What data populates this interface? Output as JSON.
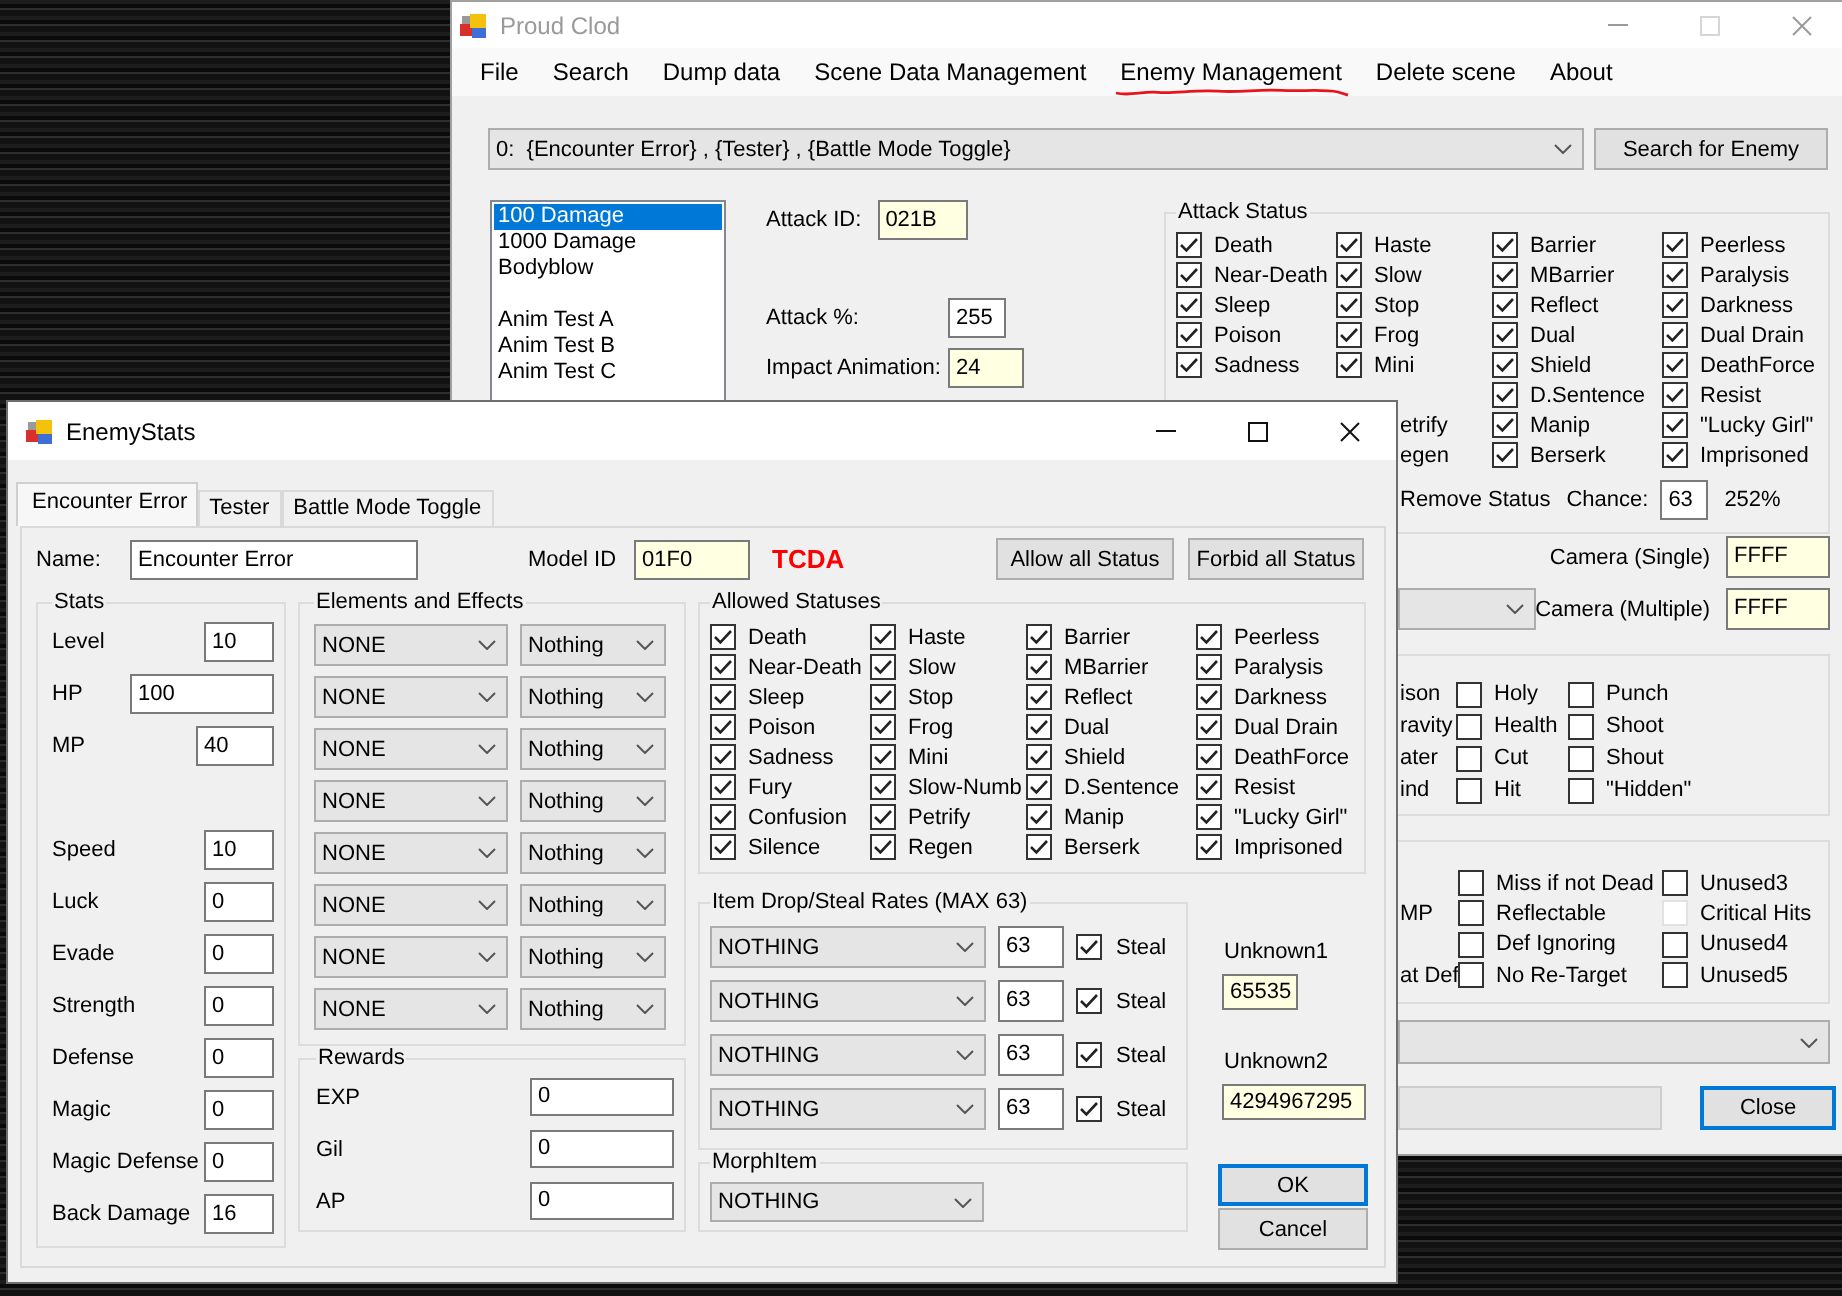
{
  "main_window": {
    "title": "Proud Clod",
    "active": false,
    "menu": [
      {
        "label": "File",
        "underlined": false
      },
      {
        "label": "Search",
        "underlined": false
      },
      {
        "label": "Dump data",
        "underlined": false
      },
      {
        "label": "Scene Data Management",
        "underlined": false
      },
      {
        "label": "Enemy Management",
        "underlined": true
      },
      {
        "label": "Delete scene",
        "underlined": false
      },
      {
        "label": "About",
        "underlined": false
      }
    ],
    "scene_select": {
      "value": "0:  {Encounter Error} , {Tester} , {Battle Mode Toggle}"
    },
    "search_button": "Search for Enemy",
    "attack_list": [
      {
        "kind": "item",
        "label": "100 Damage",
        "selected": true
      },
      {
        "kind": "item",
        "label": "1000 Damage",
        "selected": false
      },
      {
        "kind": "item",
        "label": "Bodyblow",
        "selected": false
      },
      {
        "kind": "blank"
      },
      {
        "kind": "item",
        "label": "Anim Test A",
        "selected": false
      },
      {
        "kind": "item",
        "label": "Anim Test B",
        "selected": false
      },
      {
        "kind": "item",
        "label": "Anim Test C",
        "selected": false
      }
    ],
    "attack_fields": [
      {
        "label": "Attack ID:",
        "value": "021B",
        "highlighted": true
      },
      {
        "label": "Attack %:",
        "value": "255",
        "highlighted": false
      },
      {
        "label": "Impact Animation:",
        "value": "24",
        "highlighted": true
      }
    ],
    "attack_status": {
      "title": "Attack Status",
      "rows": [
        [
          {
            "kind": "checkbox",
            "label": "Death",
            "checked": true
          },
          {
            "kind": "checkbox",
            "label": "Haste",
            "checked": true
          },
          {
            "kind": "checkbox",
            "label": "Barrier",
            "checked": true
          },
          {
            "kind": "checkbox",
            "label": "Peerless",
            "checked": true
          }
        ],
        [
          {
            "kind": "checkbox",
            "label": "Near-Death",
            "checked": true
          },
          {
            "kind": "checkbox",
            "label": "Slow",
            "checked": true
          },
          {
            "kind": "checkbox",
            "label": "MBarrier",
            "checked": true
          },
          {
            "kind": "checkbox",
            "label": "Paralysis",
            "checked": true
          }
        ],
        [
          {
            "kind": "checkbox",
            "label": "Sleep",
            "checked": true
          },
          {
            "kind": "checkbox",
            "label": "Stop",
            "checked": true
          },
          {
            "kind": "checkbox",
            "label": "Reflect",
            "checked": true
          },
          {
            "kind": "checkbox",
            "label": "Darkness",
            "checked": true
          }
        ],
        [
          {
            "kind": "checkbox",
            "label": "Poison",
            "checked": true
          },
          {
            "kind": "checkbox",
            "label": "Frog",
            "checked": true
          },
          {
            "kind": "checkbox",
            "label": "Dual",
            "checked": true
          },
          {
            "kind": "checkbox",
            "label": "Dual Drain",
            "checked": true
          }
        ],
        [
          {
            "kind": "checkbox",
            "label": "Sadness",
            "checked": true
          },
          {
            "kind": "checkbox",
            "label": "Mini",
            "checked": true
          },
          {
            "kind": "checkbox",
            "label": "Shield",
            "checked": true
          },
          {
            "kind": "checkbox",
            "label": "DeathForce",
            "checked": true
          }
        ],
        [
          "",
          "",
          {
            "kind": "checkbox",
            "label": "D.Sentence",
            "checked": true
          },
          {
            "kind": "checkbox",
            "label": "Resist",
            "checked": true
          }
        ],
        [
          "",
          {
            "kind": "fragment",
            "label": "etrify"
          },
          {
            "kind": "checkbox",
            "label": "Manip",
            "checked": true
          },
          {
            "kind": "checkbox",
            "label": "\"Lucky Girl\"",
            "checked": true
          }
        ],
        [
          "",
          {
            "kind": "fragment",
            "label": "egen"
          },
          {
            "kind": "checkbox",
            "label": "Berserk",
            "checked": true
          },
          {
            "kind": "checkbox",
            "label": "Imprisoned",
            "checked": true
          }
        ]
      ],
      "remove_status": "Remove Status",
      "chance_label": "Chance:",
      "chance": "63",
      "chance_percent": "252%"
    },
    "camera_rows": [
      {
        "label": "Camera (Single)",
        "value": "FFFF",
        "highlighted": true,
        "dropdown": false
      },
      {
        "label": "Camera (Multiple)",
        "value": "FFFF",
        "highlighted": true,
        "dropdown": true
      }
    ],
    "element_group": {
      "rows": [
        [
          {
            "kind": "fragment",
            "label": "ison"
          },
          {
            "kind": "checkbox",
            "label": "Holy",
            "checked": false
          },
          {
            "kind": "checkbox",
            "label": "Punch",
            "checked": false
          }
        ],
        [
          {
            "kind": "fragment",
            "label": "ravity"
          },
          {
            "kind": "checkbox",
            "label": "Health",
            "checked": false
          },
          {
            "kind": "checkbox",
            "label": "Shoot",
            "checked": false
          }
        ],
        [
          {
            "kind": "fragment",
            "label": "ater"
          },
          {
            "kind": "checkbox",
            "label": "Cut",
            "checked": false
          },
          {
            "kind": "checkbox",
            "label": "Shout",
            "checked": false
          }
        ],
        [
          {
            "kind": "fragment",
            "label": "ind"
          },
          {
            "kind": "checkbox",
            "label": "Hit",
            "checked": false
          },
          {
            "kind": "checkbox",
            "label": "\"Hidden\"",
            "checked": false
          }
        ]
      ]
    },
    "flag_group": {
      "rows": [
        [
          "",
          {
            "kind": "checkbox",
            "label": "Miss if not Dead",
            "checked": false,
            "disabled": false
          },
          {
            "kind": "checkbox",
            "label": "Unused3",
            "checked": false,
            "disabled": false
          }
        ],
        [
          {
            "kind": "fragment",
            "label": "MP"
          },
          {
            "kind": "checkbox",
            "label": "Reflectable",
            "checked": false,
            "disabled": false
          },
          {
            "kind": "checkbox",
            "label": "Critical Hits",
            "checked": false,
            "disabled": true
          }
        ],
        [
          "",
          {
            "kind": "checkbox",
            "label": "Def Ignoring",
            "checked": false,
            "disabled": false
          },
          {
            "kind": "checkbox",
            "label": "Unused4",
            "checked": false,
            "disabled": false
          }
        ],
        [
          {
            "kind": "fragment",
            "label": "at Def"
          },
          {
            "kind": "checkbox",
            "label": "No Re-Target",
            "checked": false,
            "disabled": false
          },
          {
            "kind": "checkbox",
            "label": "Unused5",
            "checked": false,
            "disabled": false
          }
        ]
      ]
    },
    "lower_controls": [
      {
        "kind": "dropdown"
      },
      {
        "kind": "field",
        "disabled": true
      },
      {
        "kind": "button",
        "label": "Close",
        "focused": true
      }
    ]
  },
  "enemy_window": {
    "title": "EnemyStats",
    "active": true,
    "tabs": [
      {
        "label": "Encounter Error",
        "selected": true
      },
      {
        "label": "Tester",
        "selected": false
      },
      {
        "label": "Battle Mode Toggle",
        "selected": false
      }
    ],
    "name_label": "Name:",
    "name": "Encounter Error",
    "model_id_label": "Model ID",
    "model_id": "01F0",
    "model_code": "TCDA",
    "status_buttons": [
      "Allow all Status",
      "Forbid all Status"
    ],
    "stats": {
      "title": "Stats",
      "groups": [
        [
          {
            "label": "Level",
            "value": "10"
          },
          {
            "label": "HP",
            "value": "100"
          },
          {
            "label": "MP",
            "value": "40"
          }
        ],
        [
          {
            "label": "Speed",
            "value": "10"
          },
          {
            "label": "Luck",
            "value": "0"
          },
          {
            "label": "Evade",
            "value": "0"
          },
          {
            "label": "Strength",
            "value": "0"
          },
          {
            "label": "Defense",
            "value": "0"
          },
          {
            "label": "Magic",
            "value": "0"
          },
          {
            "label": "Magic Defense",
            "value": "0"
          },
          {
            "label": "Back Damage",
            "value": "16"
          }
        ]
      ]
    },
    "elements": {
      "title": "Elements and Effects",
      "rows": [
        {
          "element": "NONE",
          "effect": "Nothing"
        },
        {
          "element": "NONE",
          "effect": "Nothing"
        },
        {
          "element": "NONE",
          "effect": "Nothing"
        },
        {
          "element": "NONE",
          "effect": "Nothing"
        },
        {
          "element": "NONE",
          "effect": "Nothing"
        },
        {
          "element": "NONE",
          "effect": "Nothing"
        },
        {
          "element": "NONE",
          "effect": "Nothing"
        },
        {
          "element": "NONE",
          "effect": "Nothing"
        }
      ]
    },
    "rewards": {
      "title": "Rewards",
      "rows": [
        {
          "label": "EXP",
          "value": "0"
        },
        {
          "label": "Gil",
          "value": "0"
        },
        {
          "label": "AP",
          "value": "0"
        }
      ]
    },
    "allowed_statuses": {
      "title": "Allowed Statuses",
      "rows": [
        [
          {
            "kind": "checkbox",
            "label": "Death",
            "checked": true
          },
          {
            "kind": "checkbox",
            "label": "Haste",
            "checked": true
          },
          {
            "kind": "checkbox",
            "label": "Barrier",
            "checked": true
          },
          {
            "kind": "checkbox",
            "label": "Peerless",
            "checked": true
          }
        ],
        [
          {
            "kind": "checkbox",
            "label": "Near-Death",
            "checked": true
          },
          {
            "kind": "checkbox",
            "label": "Slow",
            "checked": true
          },
          {
            "kind": "checkbox",
            "label": "MBarrier",
            "checked": true
          },
          {
            "kind": "checkbox",
            "label": "Paralysis",
            "checked": true
          }
        ],
        [
          {
            "kind": "checkbox",
            "label": "Sleep",
            "checked": true
          },
          {
            "kind": "checkbox",
            "label": "Stop",
            "checked": true
          },
          {
            "kind": "checkbox",
            "label": "Reflect",
            "checked": true
          },
          {
            "kind": "checkbox",
            "label": "Darkness",
            "checked": true
          }
        ],
        [
          {
            "kind": "checkbox",
            "label": "Poison",
            "checked": true
          },
          {
            "kind": "checkbox",
            "label": "Frog",
            "checked": true
          },
          {
            "kind": "checkbox",
            "label": "Dual",
            "checked": true
          },
          {
            "kind": "checkbox",
            "label": "Dual Drain",
            "checked": true
          }
        ],
        [
          {
            "kind": "checkbox",
            "label": "Sadness",
            "checked": true
          },
          {
            "kind": "checkbox",
            "label": "Mini",
            "checked": true
          },
          {
            "kind": "checkbox",
            "label": "Shield",
            "checked": true
          },
          {
            "kind": "checkbox",
            "label": "DeathForce",
            "checked": true
          }
        ],
        [
          {
            "kind": "checkbox",
            "label": "Fury",
            "checked": true
          },
          {
            "kind": "checkbox",
            "label": "Slow-Numb",
            "checked": true
          },
          {
            "kind": "checkbox",
            "label": "D.Sentence",
            "checked": true
          },
          {
            "kind": "checkbox",
            "label": "Resist",
            "checked": true
          }
        ],
        [
          {
            "kind": "checkbox",
            "label": "Confusion",
            "checked": true
          },
          {
            "kind": "checkbox",
            "label": "Petrify",
            "checked": true
          },
          {
            "kind": "checkbox",
            "label": "Manip",
            "checked": true
          },
          {
            "kind": "checkbox",
            "label": "\"Lucky Girl\"",
            "checked": true
          }
        ],
        [
          {
            "kind": "checkbox",
            "label": "Silence",
            "checked": true
          },
          {
            "kind": "checkbox",
            "label": "Regen",
            "checked": true
          },
          {
            "kind": "checkbox",
            "label": "Berserk",
            "checked": true
          },
          {
            "kind": "checkbox",
            "label": "Imprisoned",
            "checked": true
          }
        ]
      ]
    },
    "drops": {
      "title": "Item Drop/Steal Rates (MAX 63)",
      "rows": [
        {
          "item": "NOTHING",
          "rate": "63",
          "steal": {
            "label": "Steal",
            "checked": true
          }
        },
        {
          "item": "NOTHING",
          "rate": "63",
          "steal": {
            "label": "Steal",
            "checked": true
          }
        },
        {
          "item": "NOTHING",
          "rate": "63",
          "steal": {
            "label": "Steal",
            "checked": true
          }
        },
        {
          "item": "NOTHING",
          "rate": "63",
          "steal": {
            "label": "Steal",
            "checked": true
          }
        }
      ]
    },
    "unknowns": [
      {
        "label": "Unknown1",
        "value": "65535",
        "highlighted": true
      },
      {
        "label": "Unknown2",
        "value": "4294967295",
        "highlighted": true
      }
    ],
    "morph": {
      "title": "MorphItem",
      "value": "NOTHING"
    },
    "buttons": [
      {
        "label": "OK",
        "focused": true
      },
      {
        "label": "Cancel",
        "focused": false
      }
    ]
  }
}
